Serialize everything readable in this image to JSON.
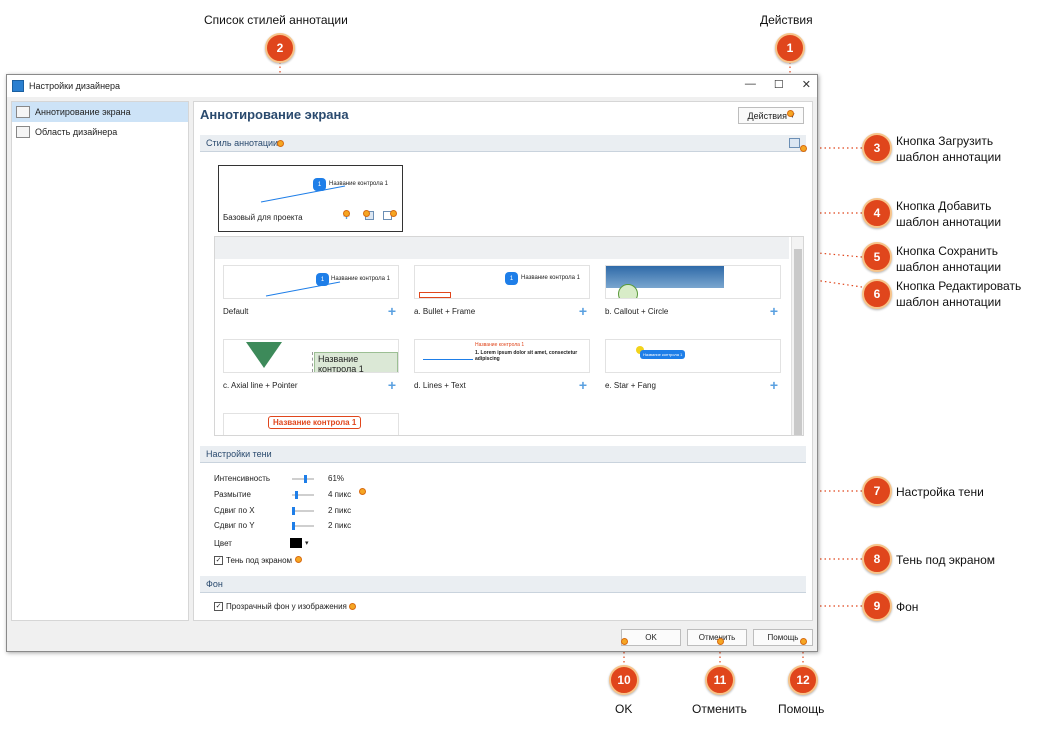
{
  "window": {
    "title": "Настройки дизайнера"
  },
  "sidebar": {
    "items": [
      {
        "label": "Аннотирование экрана"
      },
      {
        "label": "Область дизайнера"
      }
    ]
  },
  "main": {
    "title": "Аннотирование экрана",
    "actions_label": "Действия",
    "annotation_style_header": "Стиль аннотации",
    "project_base": {
      "label": "Базовый для проекта",
      "control_name": "Название контрола 1",
      "bubble_num": "1"
    },
    "styles": [
      {
        "label": "Default",
        "control_name": "Название контрола 1"
      },
      {
        "label": "a. Bullet + Frame",
        "control_name": "Название контрола 1"
      },
      {
        "label": "b. Callout + Circle"
      },
      {
        "label": "c. Axial line + Pointer",
        "control_name": "Название контрола 1"
      },
      {
        "label": "d. Lines + Text",
        "control_name": "Название контрола 1",
        "body": "1. Lorem ipsum dolor sit amet, consectetur adipiscing"
      },
      {
        "label": "e. Star + Fang",
        "control_name": "Название контрола 1"
      },
      {
        "label": "",
        "control_name": "Название контрола 1"
      }
    ],
    "shadow_header": "Настройки тени",
    "shadow": {
      "intensity_label": "Интенсивность",
      "intensity_value": "61%",
      "blur_label": "Размытие",
      "blur_value": "4 пикс",
      "offset_x_label": "Сдвиг по X",
      "offset_x_value": "2 пикс",
      "offset_y_label": "Сдвиг по Y",
      "offset_y_value": "2 пикс",
      "color_label": "Цвет",
      "under_screen_label": "Тень под экраном"
    },
    "background_header": "Фон",
    "transparent_bg_label": "Прозрачный фон у изображения"
  },
  "buttons": {
    "ok": "OK",
    "cancel": "Отменить",
    "help": "Помощь"
  },
  "callouts": {
    "c1": {
      "num": "1",
      "text": "Действия"
    },
    "c2": {
      "num": "2",
      "text": "Список стилей аннотации"
    },
    "c3": {
      "num": "3",
      "text1": "Кнопка Загрузить",
      "text2": "шаблон аннотации"
    },
    "c4": {
      "num": "4",
      "text1": "Кнопка Добавить",
      "text2": "шаблон аннотации"
    },
    "c5": {
      "num": "5",
      "text1": "Кнопка Сохранить",
      "text2": "шаблон аннотации"
    },
    "c6": {
      "num": "6",
      "text1": "Кнопка Редактировать",
      "text2": "шаблон аннотации"
    },
    "c7": {
      "num": "7",
      "text": "Настройка тени"
    },
    "c8": {
      "num": "8",
      "text": "Тень под экраном"
    },
    "c9": {
      "num": "9",
      "text": "Фон"
    },
    "c10": {
      "num": "10",
      "text": "OK"
    },
    "c11": {
      "num": "11",
      "text": "Отменить"
    },
    "c12": {
      "num": "12",
      "text": "Помощь"
    }
  }
}
